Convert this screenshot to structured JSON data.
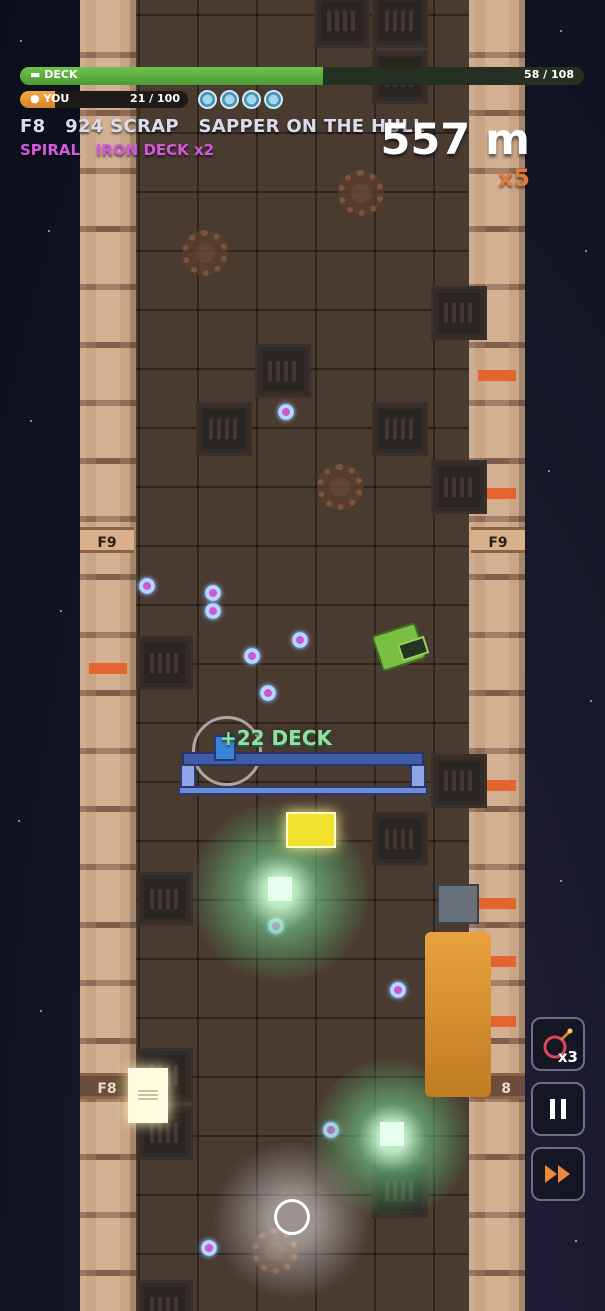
{
  "hud": {
    "deck_label": "DECK",
    "deck_value": "58 / 108",
    "deck_fraction": 0.537,
    "you_label": "YOU",
    "you_value": "21 / 100",
    "you_fraction": 0.21,
    "shield_pips": 4,
    "floor": "F8",
    "scrap": "924 SCRAP",
    "event": "SAPPER ON THE HULL",
    "modifier_1": "SPIRAL",
    "modifier_2": "IRON DECK x2",
    "distance": "557 m",
    "multiplier": "x5"
  },
  "world": {
    "floor_tag_upper": "F9",
    "floor_tag_lower": "F8",
    "floor_tag_lower_right": "8",
    "popup": "+22 DECK"
  },
  "controls": {
    "bomb_count": "x3",
    "pause_icon": "pause-icon",
    "fast_forward_icon": "fast-forward-icon"
  },
  "colors": {
    "deck_bar": "#5aac3c",
    "you_bar": "#f0a13c",
    "modifier_text": "#d458e0",
    "multiplier_text": "#e07a36",
    "popup_text": "#8fe0a2"
  }
}
